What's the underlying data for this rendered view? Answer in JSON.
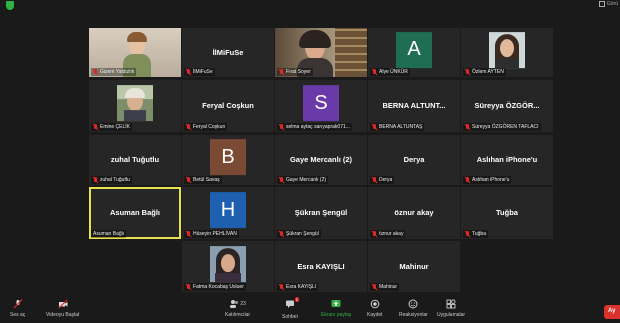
{
  "top_right": {
    "label": "Görü"
  },
  "tiles": [
    {
      "display": "Gizem Yaldızlık",
      "label": "Gizem Yaldızlık",
      "type": "video"
    },
    {
      "display": "İlMiFuSe",
      "label": "İlMiFuSe",
      "type": "name"
    },
    {
      "display": "Fırat Soyer",
      "label": "Fırat Soyer",
      "type": "video"
    },
    {
      "display": "A",
      "label": "Alye ÜNKÜR",
      "type": "avatar",
      "color": "#1f6d52"
    },
    {
      "display": "Özlem AYTEN",
      "label": "Özlem AYTEN",
      "type": "photo"
    },
    {
      "display": "Emine ÇELİK",
      "label": "Emine ÇELİK",
      "type": "photo"
    },
    {
      "display": "Feryal Coşkun",
      "label": "Feryal Coşkun",
      "type": "name"
    },
    {
      "display": "S",
      "label": "selma aytaç sarıyaprak071...",
      "type": "avatar",
      "color": "#6a3aa8"
    },
    {
      "display": "BERNA ALTUNT...",
      "label": "BERNA ALTUNTAŞ",
      "type": "name"
    },
    {
      "display": "Süreyya ÖZGÖR...",
      "label": "Süreyya ÖZGÖREN TAFLACI",
      "type": "name"
    },
    {
      "display": "zuhal Tuğutlu",
      "label": "zuhal Tuğutlu",
      "type": "name"
    },
    {
      "display": "B",
      "label": "Betül Savaş",
      "type": "avatar",
      "color": "#7a4a35"
    },
    {
      "display": "Gaye Mercanlı (2)",
      "label": "Gaye Mercanlı (2)",
      "type": "name"
    },
    {
      "display": "Derya",
      "label": "Derya",
      "type": "name"
    },
    {
      "display": "Aslıhan iPhone'u",
      "label": "Aslıhan iPhone'u",
      "type": "name"
    },
    {
      "display": "Asuman Bağlı",
      "label": "Asuman Bağlı",
      "type": "name",
      "active": true
    },
    {
      "display": "H",
      "label": "Hüseyin PEHLİVAN",
      "type": "avatar",
      "color": "#1f5fb0"
    },
    {
      "display": "Şükran Şengül",
      "label": "Şükran Şengül",
      "type": "name"
    },
    {
      "display": "öznur akay",
      "label": "öznur akay",
      "type": "name"
    },
    {
      "display": "Tuğba",
      "label": "Tuğba",
      "type": "name"
    },
    {
      "display": "Fatma Kocabaş Usluer",
      "label": "Fatma Kocabaş Usluer",
      "type": "photo"
    },
    {
      "display": "Esra KAYIŞLI",
      "label": "Esra KAYIŞLI",
      "type": "name"
    },
    {
      "display": "Mahinur",
      "label": "Mahinur",
      "type": "name"
    }
  ],
  "toolbar": {
    "mute": "Ses aç",
    "video": "Videoyu Başlat",
    "participants": "Katılımcılar",
    "participants_count": "23",
    "chat": "Sohbet",
    "chat_badge": "1",
    "share": "Ekranı paylaş",
    "record": "Kaydet",
    "reactions": "Reaksiyonlar",
    "apps": "Uygulamalar",
    "leave": "Ay"
  },
  "colors": {
    "active_speaker": "#e8e04f",
    "muted": "#e02828",
    "share": "#2fb344",
    "leave": "#d9312b"
  }
}
